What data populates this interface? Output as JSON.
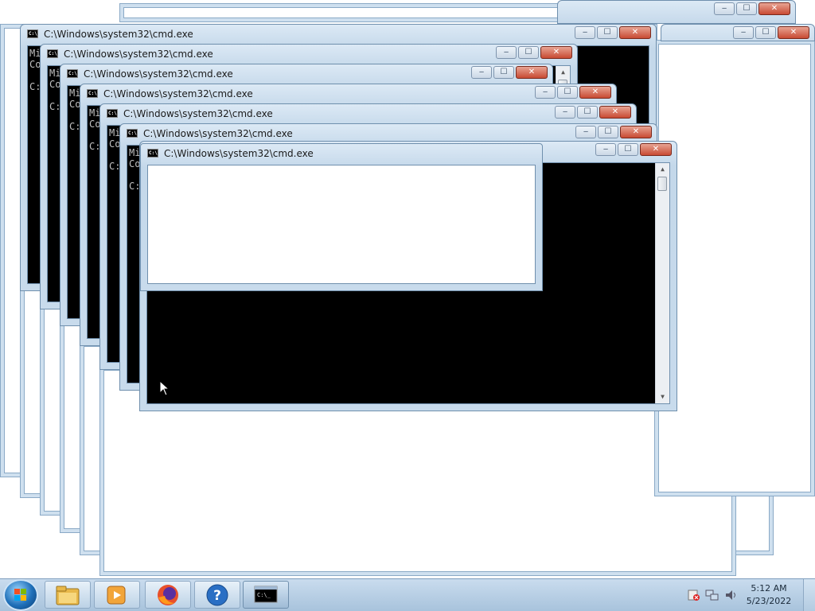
{
  "window_title": "C:\\Windows\\system32\\cmd.exe",
  "cmd_lines": [
    "Mi",
    "Co",
    "",
    "C:"
  ],
  "controls": {
    "minimize": "‒",
    "maximize": "☐",
    "close": "✕"
  },
  "taskbar": {
    "pinned": [
      "start-button",
      "windows-explorer",
      "windows-media-player",
      "firefox",
      "help-and-support",
      "command-prompt"
    ],
    "tray_icons": [
      "action-center-icon",
      "network-icon",
      "volume-icon"
    ],
    "clock": {
      "time": "5:12 AM",
      "date": "5/23/2022"
    }
  }
}
